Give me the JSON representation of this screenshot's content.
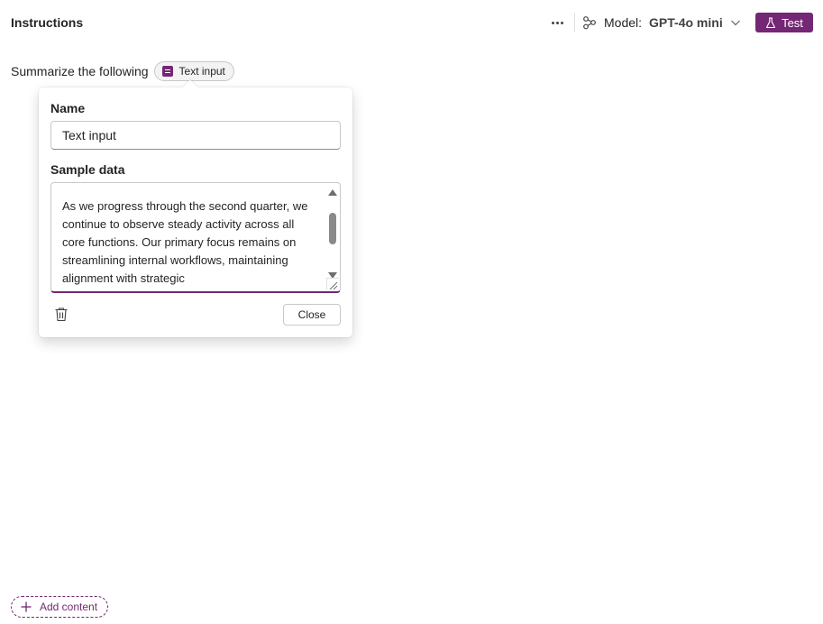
{
  "header": {
    "title": "Instructions",
    "more_icon": "more-horizontal-icon",
    "model_icon": "model-network-icon",
    "model_label": "Model:",
    "model_value": "GPT-4o mini",
    "test_label": "Test",
    "test_icon": "flask-icon",
    "accent_color": "#742774"
  },
  "prompt": {
    "text": "Summarize the following",
    "chip_label": "Text input",
    "chip_icon": "text-document-icon"
  },
  "popover": {
    "name_label": "Name",
    "name_value": "Text input",
    "sample_label": "Sample data",
    "sample_text": "As we progress through the second quarter, we continue to observe steady activity across all core functions. Our primary focus remains on streamlining internal workflows, maintaining alignment with strategic",
    "delete_icon": "trash-icon",
    "close_label": "Close"
  },
  "footer": {
    "add_content_label": "Add content",
    "add_icon": "plus-icon"
  }
}
